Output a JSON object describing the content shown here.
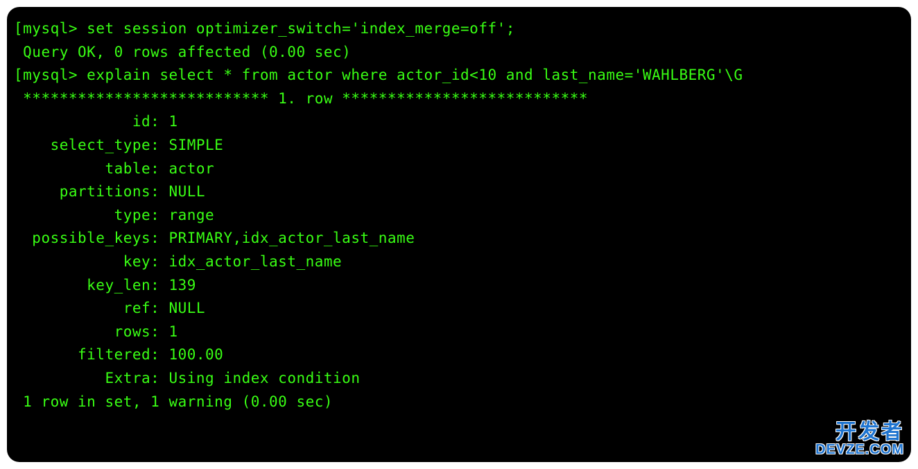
{
  "terminal": {
    "prompt": "mysql>",
    "command1": "set session optimizer_switch='index_merge=off';",
    "result1": "Query OK, 0 rows affected (0.00 sec)",
    "blank": "",
    "command2": "explain select * from actor where actor_id<10 and last_name='WAHLBERG'\\G",
    "row_separator": "*************************** 1. row ***************************",
    "rows": [
      {
        "key": "id",
        "value": "1"
      },
      {
        "key": "select_type",
        "value": "SIMPLE"
      },
      {
        "key": "table",
        "value": "actor"
      },
      {
        "key": "partitions",
        "value": "NULL"
      },
      {
        "key": "type",
        "value": "range"
      },
      {
        "key": "possible_keys",
        "value": "PRIMARY,idx_actor_last_name"
      },
      {
        "key": "key",
        "value": "idx_actor_last_name"
      },
      {
        "key": "key_len",
        "value": "139"
      },
      {
        "key": "ref",
        "value": "NULL"
      },
      {
        "key": "rows",
        "value": "1"
      },
      {
        "key": "filtered",
        "value": "100.00"
      },
      {
        "key": "Extra",
        "value": "Using index condition"
      }
    ],
    "footer": "1 row in set, 1 warning (0.00 sec)"
  },
  "watermark": {
    "top": "开发者",
    "bottom": "DEVZE.COM"
  }
}
